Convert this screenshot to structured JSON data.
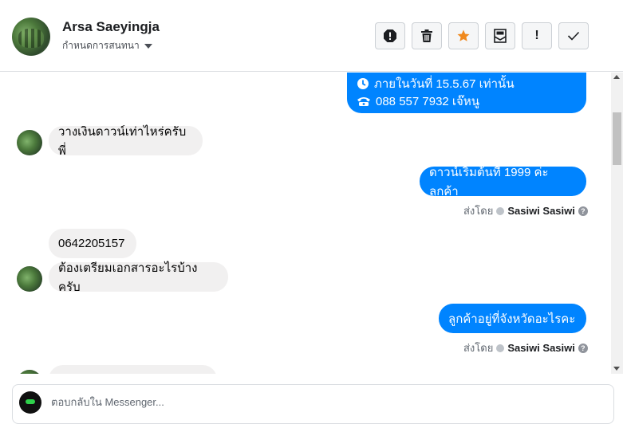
{
  "header": {
    "contact_name": "Arsa Saeyingja",
    "assign_label": "กำหนดการสนทนา",
    "toolbar": [
      {
        "icon": "spam-alert-icon"
      },
      {
        "icon": "trash-icon"
      },
      {
        "icon": "star-icon",
        "color": "#f0891d"
      },
      {
        "icon": "mark-unread-icon"
      },
      {
        "icon": "follow-up-icon",
        "glyph": "!"
      },
      {
        "icon": "checkmark-done-icon"
      }
    ]
  },
  "thread": {
    "top_bubble": {
      "line1": "ภายในวันที่ 15.5.67 เท่านั้น",
      "line2": "088 557 7932 เจ๊หนู"
    },
    "messages": [
      {
        "direction": "in",
        "text": "วางเงินดาวน์เท่าไหร่ครับพี่"
      },
      {
        "direction": "out",
        "text": "ดาวน์เริ่มต้นที่ 1999 ค่ะลูกค้า"
      },
      {
        "direction": "in",
        "text": "0642205157"
      },
      {
        "direction": "in",
        "text": "ต้องเตรียมเอกสารอะไรบ้างครับ"
      },
      {
        "direction": "out",
        "text": "ลูกค้าอยู่ที่จังหวัดอะไรคะ"
      }
    ],
    "sent_by": {
      "prefix": "ส่งโดย",
      "name": "Sasiwi Sasiwi"
    }
  },
  "composer": {
    "placeholder": "ตอบกลับใน Messenger..."
  },
  "colors": {
    "outgoing_bubble": "#0084ff",
    "incoming_bubble": "#f1f0f0",
    "star": "#f0891d"
  }
}
